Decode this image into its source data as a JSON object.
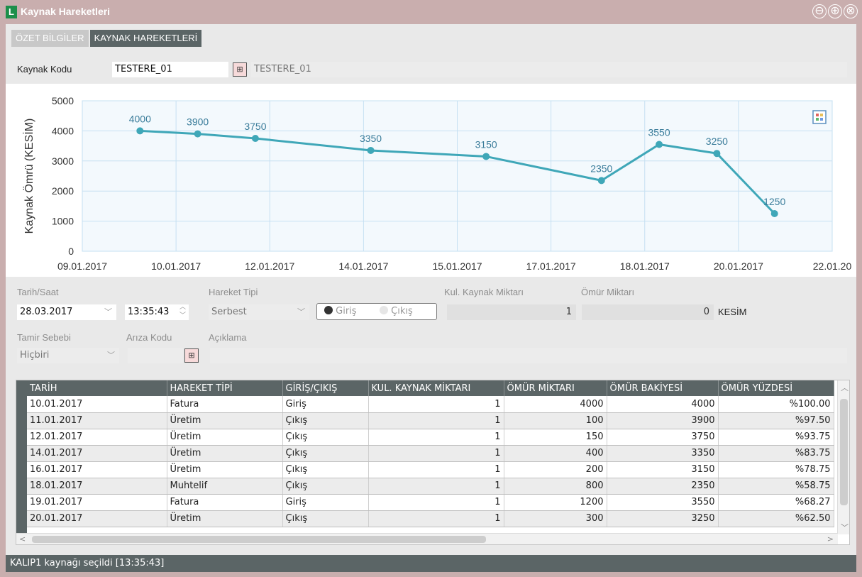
{
  "window": {
    "title": "Kaynak Hareketleri",
    "app_icon_letter": "L",
    "buttons": [
      "⊖",
      "⊕",
      "⊗"
    ]
  },
  "tabs": [
    {
      "label": "ÖZET BİLGİLER",
      "active": false
    },
    {
      "label": "KAYNAK HAREKETLERİ",
      "active": true
    }
  ],
  "resource": {
    "label": "Kaynak Kodu",
    "value": "TESTERE_01",
    "description": "TESTERE_01"
  },
  "chart_data": {
    "type": "line",
    "ylabel": "Kaynak Ömrü (KESİM)",
    "ylim": [
      0,
      5000
    ],
    "yticks": [
      "0",
      "1000",
      "2000",
      "3000",
      "4000",
      "5000"
    ],
    "xticks": [
      "09.01.2017",
      "10.01.2017",
      "12.01.2017",
      "14.01.2017",
      "15.01.2017",
      "17.01.2017",
      "18.01.2017",
      "20.01.2017",
      "22.01.20"
    ],
    "x": [
      "10.01.2017",
      "11.01.2017",
      "12.01.2017",
      "14.01.2017",
      "16.01.2017",
      "18.01.2017",
      "19.01.2017",
      "20.01.2017",
      "21.01.2017"
    ],
    "values": [
      4000,
      3900,
      3750,
      3350,
      3150,
      2350,
      3550,
      3250,
      1250
    ],
    "line_color": "#3fa7b8",
    "grid": true
  },
  "form": {
    "date_label": "Tarih/Saat",
    "date": "28.03.2017",
    "time": "13:35:43",
    "movement_type_label": "Hareket Tipi",
    "movement_type": "Serbest",
    "in_label": "Giriş",
    "out_label": "Çıkış",
    "used_qty_label": "Kul. Kaynak Miktarı",
    "used_qty": "1",
    "life_qty_label": "Ömür Miktarı",
    "life_qty": "0",
    "unit": "KESİM",
    "repair_label": "Tamir Sebebi",
    "repair_value": "Hiçbiri",
    "fault_label": "Arıza Kodu",
    "fault_value": "",
    "desc_label": "Açıklama",
    "desc_value": ""
  },
  "grid": {
    "columns": [
      "TARİH",
      "HAREKET TİPİ",
      "GİRİŞ/ÇIKIŞ",
      "KUL. KAYNAK MİKTARI",
      "ÖMÜR MİKTARI",
      "ÖMÜR BAKİYESİ",
      "ÖMÜR YÜZDESİ"
    ],
    "rows": [
      [
        "10.01.2017",
        "Fatura",
        "Giriş",
        "1",
        "4000",
        "4000",
        "%100.00"
      ],
      [
        "11.01.2017",
        "Üretim",
        "Çıkış",
        "1",
        "100",
        "3900",
        "%97.50"
      ],
      [
        "12.01.2017",
        "Üretim",
        "Çıkış",
        "1",
        "150",
        "3750",
        "%93.75"
      ],
      [
        "14.01.2017",
        "Üretim",
        "Çıkış",
        "1",
        "400",
        "3350",
        "%83.75"
      ],
      [
        "16.01.2017",
        "Üretim",
        "Çıkış",
        "1",
        "200",
        "3150",
        "%78.75"
      ],
      [
        "18.01.2017",
        "Muhtelif",
        "Çıkış",
        "1",
        "800",
        "2350",
        "%58.75"
      ],
      [
        "19.01.2017",
        "Fatura",
        "Giriş",
        "1",
        "1200",
        "3550",
        "%68.27"
      ],
      [
        "20.01.2017",
        "Üretim",
        "Çıkış",
        "1",
        "300",
        "3250",
        "%62.50"
      ]
    ]
  },
  "status": "KALIP1 kaynağı seçildi [13:35:43]"
}
